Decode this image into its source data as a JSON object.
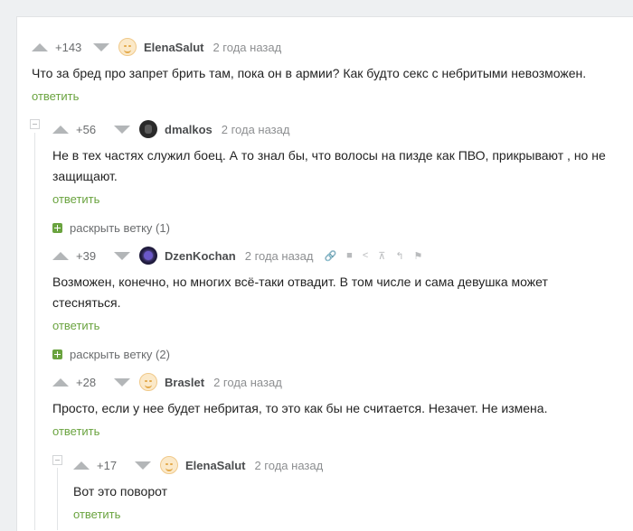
{
  "comments": [
    {
      "rating": "+143",
      "author": "ElenaSalut",
      "avatar": "smile-avatar",
      "time": "2 года назад",
      "text_lines": [
        "Что за бред про запрет брить там, пока он в армии? Как будто секс с небритыми невозможен."
      ],
      "reply": "ответить"
    },
    {
      "rating": "+56",
      "author": "dmalkos",
      "avatar": "dark-avatar",
      "time": "2 года назад",
      "text_lines": [
        "Не в тех частях служил боец. А то знал бы, что волосы на пизде как ПВО, прикрывают , но не",
        "защищают."
      ],
      "reply": "ответить",
      "expand": "раскрыть ветку (1)"
    },
    {
      "rating": "+39",
      "author": "DzenKochan",
      "avatar": "space-avatar",
      "time": "2 года назад",
      "text_lines": [
        "Возможен, конечно, но многих всё-таки отвадит. В том числе и сама девушка может",
        "стесняться."
      ],
      "reply": "ответить",
      "expand": "раскрыть ветку (2)",
      "tools": [
        "link-icon",
        "save-icon",
        "share-icon",
        "scroll-top-icon",
        "parent-icon",
        "flag-icon"
      ]
    },
    {
      "rating": "+28",
      "author": "Braslet",
      "avatar": "smile-avatar",
      "time": "2 года назад",
      "text_lines": [
        "Просто, если у нее будет небритая, то это как бы не считается. Незачет. Не измена."
      ],
      "reply": "ответить"
    },
    {
      "rating": "+17",
      "author": "ElenaSalut",
      "avatar": "smile-avatar",
      "time": "2 года назад",
      "text_lines": [
        "Вот это поворот"
      ],
      "reply": "ответить"
    }
  ]
}
